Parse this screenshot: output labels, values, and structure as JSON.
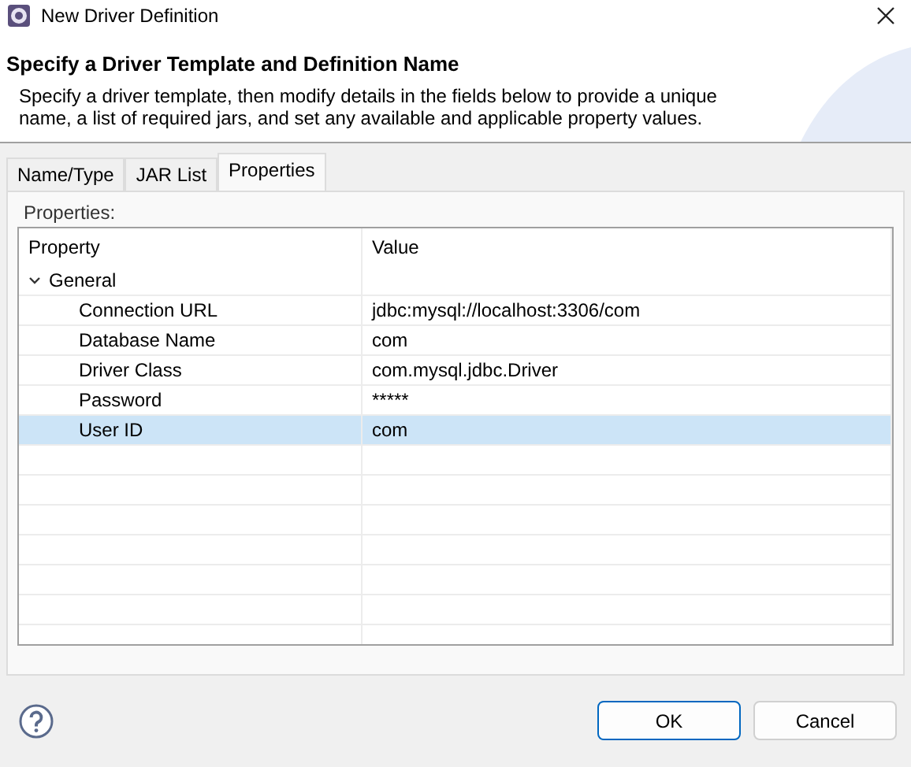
{
  "window": {
    "title": "New Driver Definition"
  },
  "header": {
    "title": "Specify a Driver Template and Definition Name",
    "description": "Specify a driver template, then modify details in the fields below to provide a unique name, a list of required jars, and set any available and applicable property values."
  },
  "tabs": [
    {
      "label": "Name/Type",
      "selected": false
    },
    {
      "label": "JAR List",
      "selected": false
    },
    {
      "label": "Properties",
      "selected": true
    }
  ],
  "properties_label": "Properties:",
  "table": {
    "columns": [
      "Property",
      "Value"
    ],
    "rows": [
      {
        "property": "General",
        "value": "",
        "expanded": true,
        "selected": false,
        "children": [
          {
            "property": "Connection URL",
            "value": "jdbc:mysql://localhost:3306/com",
            "selected": false
          },
          {
            "property": "Database Name",
            "value": "com",
            "selected": false
          },
          {
            "property": "Driver Class",
            "value": "com.mysql.jdbc.Driver",
            "selected": false
          },
          {
            "property": "Password",
            "value": "*****",
            "selected": false
          },
          {
            "property": "User ID",
            "value": "com",
            "selected": true
          }
        ]
      }
    ]
  },
  "buttons": [
    {
      "label": "OK",
      "default": true
    },
    {
      "label": "Cancel",
      "default": false
    }
  ]
}
